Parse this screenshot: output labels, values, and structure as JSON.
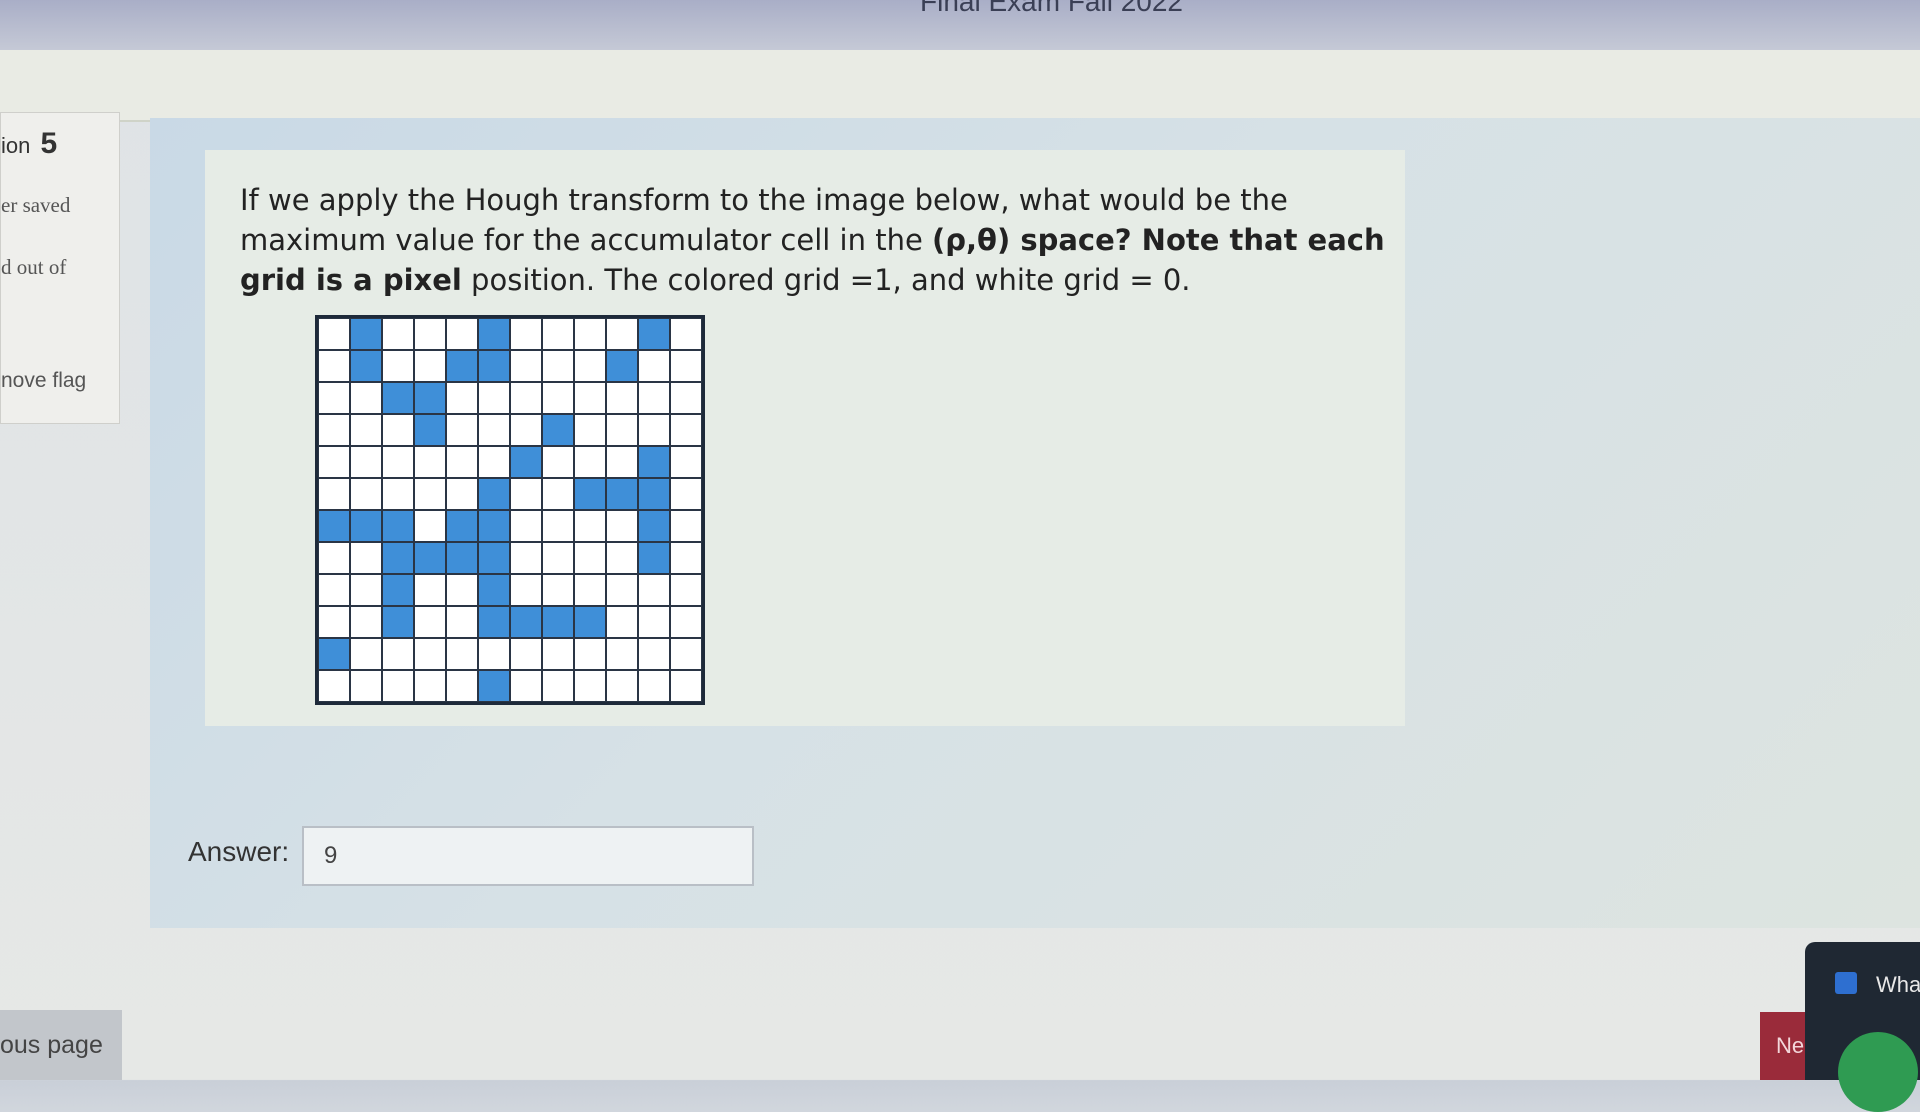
{
  "header": {
    "exam_title": "Final Exam Fall 2022"
  },
  "question_info": {
    "label": "ion",
    "number": "5",
    "state": "er saved",
    "marks": "d out of",
    "flag": "nove flag"
  },
  "question": {
    "text_normal_1": "If we apply the Hough transform to the image below, what would be the maximum value for the accumulator cell in the ",
    "text_bold": "(ρ,θ) space? Note that each grid is a pixel",
    "text_normal_2": " position. The colored grid =1, and white grid = 0.",
    "grid_size": 12,
    "grid": [
      [
        0,
        1,
        0,
        0,
        0,
        1,
        0,
        0,
        0,
        0,
        1,
        0
      ],
      [
        0,
        1,
        0,
        0,
        1,
        1,
        0,
        0,
        0,
        1,
        0,
        0
      ],
      [
        0,
        0,
        1,
        1,
        0,
        0,
        0,
        0,
        0,
        0,
        0,
        0
      ],
      [
        0,
        0,
        0,
        1,
        0,
        0,
        0,
        1,
        0,
        0,
        0,
        0
      ],
      [
        0,
        0,
        0,
        0,
        0,
        0,
        1,
        0,
        0,
        0,
        1,
        0
      ],
      [
        0,
        0,
        0,
        0,
        0,
        1,
        0,
        0,
        1,
        1,
        1,
        0
      ],
      [
        1,
        1,
        1,
        0,
        1,
        1,
        0,
        0,
        0,
        0,
        1,
        0
      ],
      [
        0,
        0,
        1,
        1,
        1,
        1,
        0,
        0,
        0,
        0,
        1,
        0
      ],
      [
        0,
        0,
        1,
        0,
        0,
        1,
        0,
        0,
        0,
        0,
        0,
        0
      ],
      [
        0,
        0,
        1,
        0,
        0,
        1,
        1,
        1,
        1,
        0,
        0,
        0
      ],
      [
        1,
        0,
        0,
        0,
        0,
        0,
        0,
        0,
        0,
        0,
        0,
        0
      ],
      [
        0,
        0,
        0,
        0,
        0,
        1,
        0,
        0,
        0,
        0,
        0,
        0
      ]
    ]
  },
  "answer": {
    "label": "Answer:",
    "value": "9"
  },
  "navigation": {
    "previous_label": "ous page",
    "next_label": "Ne"
  },
  "chat": {
    "label": "Wha"
  }
}
